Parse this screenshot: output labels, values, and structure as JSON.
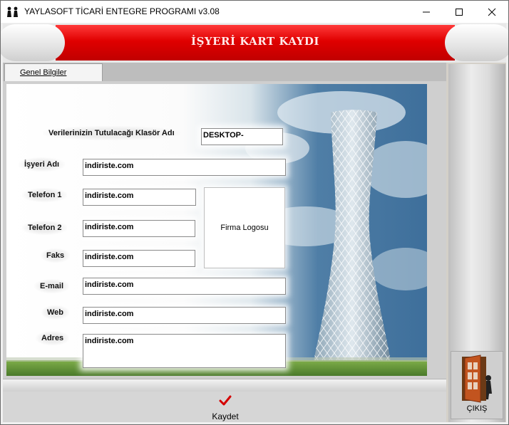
{
  "window": {
    "title": "YAYLASOFT TİCARİ ENTEGRE PROGRAMI v3.08",
    "minimize": "—",
    "maximize": "☐",
    "close": "✕"
  },
  "banner": {
    "title": "İŞYERİ KART KAYDI"
  },
  "tabs": [
    {
      "label": "Genel Bilgiler"
    }
  ],
  "form": {
    "folder_label": "Verilerinizin Tutulacağı Klasör Adı",
    "folder_value": "DESKTOP-",
    "company_label": "İşyeri Adı",
    "company_value": "indiriste.com",
    "phone1_label": "Telefon 1",
    "phone1_value": "indiriste.com",
    "phone2_label": "Telefon 2",
    "phone2_value": "indiriste.com",
    "fax_label": "Faks",
    "fax_value": "indiriste.com",
    "email_label": "E-mail",
    "email_value": "indiriste.com",
    "web_label": "Web",
    "web_value": "indiriste.com",
    "address_label": "Adres",
    "address_value": "indiriste.com",
    "logo_label": "Firma Logosu"
  },
  "actions": {
    "save_label": "Kaydet",
    "exit_label": "ÇIKIŞ"
  },
  "icons": {
    "app": "users-icon",
    "save": "checkmark-icon",
    "exit": "door-exit-icon"
  },
  "colors": {
    "banner_red": "#e00000",
    "save_check": "#d40000",
    "door": "#b5441c"
  }
}
